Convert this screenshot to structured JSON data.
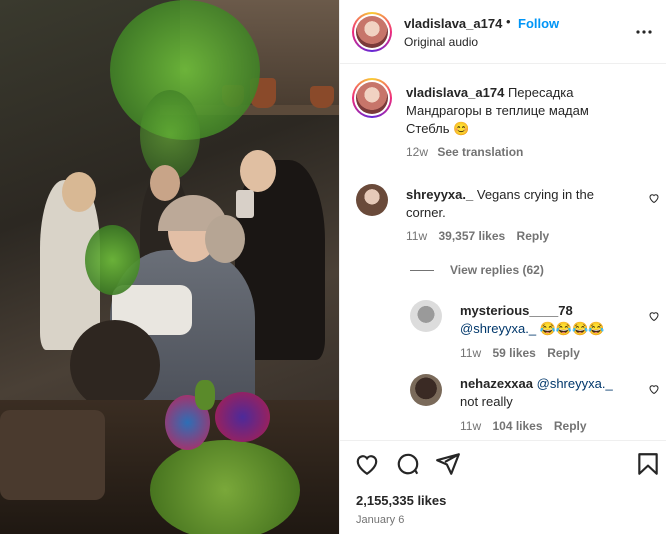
{
  "post": {
    "username": "vladislava_a174",
    "separator": "•",
    "follow_label": "Follow",
    "audio_label": "Original audio",
    "caption_user": "vladislava_a174",
    "caption_text": "Пересадка Мандрагоры в теплице мадам Стебль",
    "caption_emoji": "😊",
    "caption_age": "12w",
    "see_translation": "See translation",
    "likes": "2,155,335 likes",
    "date": "January 6"
  },
  "comments": [
    {
      "user": "shreyyxa._",
      "text": "Vegans crying in the corner.",
      "age": "11w",
      "likes": "39,357 likes",
      "reply": "Reply",
      "view_replies": "View replies (62)"
    },
    {
      "user": "mysterious____78",
      "mention": "@shreyyxa._",
      "text": "😂😂😂😂",
      "age": "11w",
      "likes": "59 likes",
      "reply": "Reply"
    },
    {
      "user": "nehazexxaa",
      "mention": "@shreyyxa._",
      "text": "not really",
      "age": "11w",
      "likes": "104 likes",
      "reply": "Reply"
    }
  ],
  "icons": {
    "more": "more-options-icon",
    "like": "heart-icon",
    "comment": "comment-icon",
    "share": "share-icon",
    "save": "bookmark-icon"
  },
  "colors": {
    "follow": "#0095f6",
    "meta": "#737373",
    "mention": "#00376b"
  }
}
